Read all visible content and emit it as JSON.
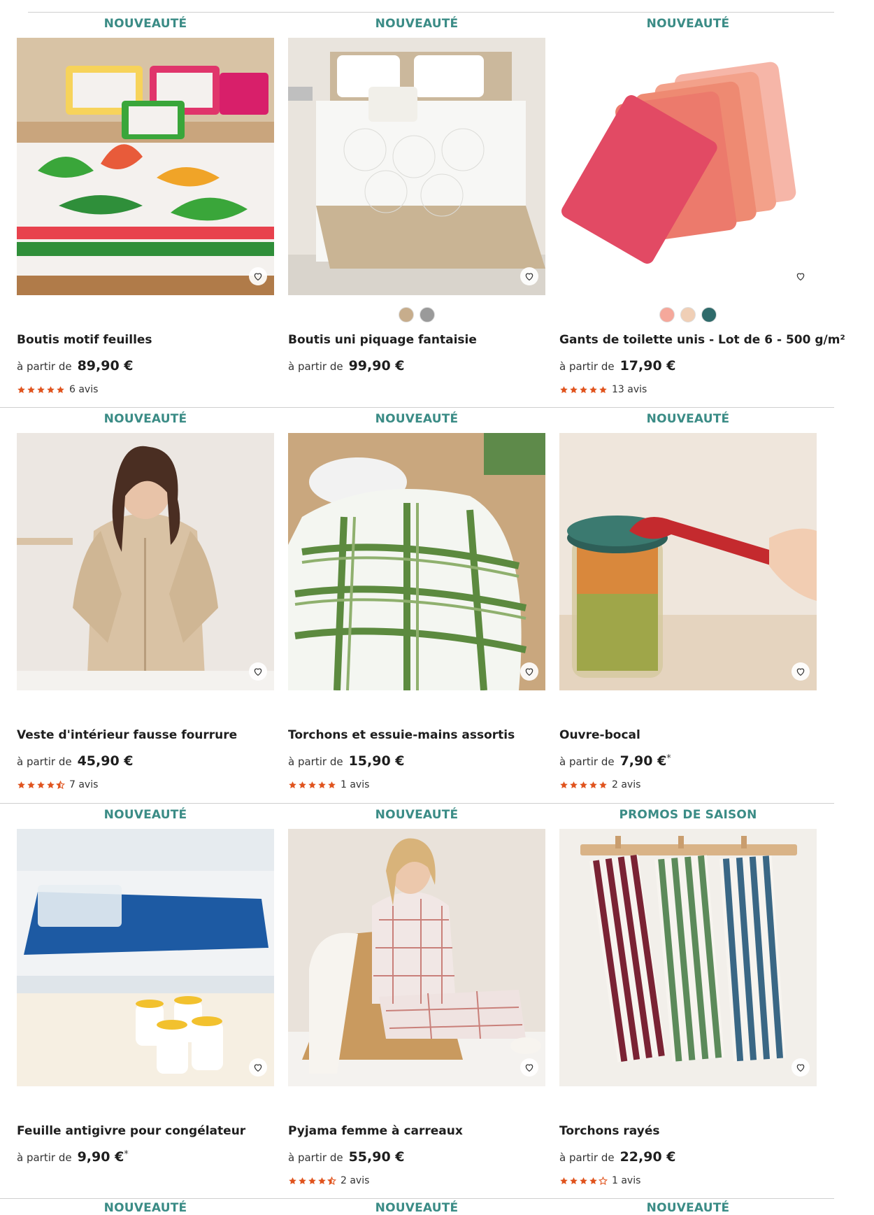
{
  "accent": "#3b8c86",
  "rating_color": "#e0541e",
  "products": [
    {
      "badge": "NOUVEAUTÉ",
      "title": "Boutis motif feuilles",
      "from": "à partir de",
      "price": "89,90 €",
      "asterisk": "",
      "rating": 5,
      "reviews": "6 avis",
      "swatches": [],
      "image": "floral-quilt-bed"
    },
    {
      "badge": "NOUVEAUTÉ",
      "title": "Boutis uni piquage fantaisie",
      "from": "à partir de",
      "price": "99,90 €",
      "asterisk": "",
      "rating": null,
      "reviews": "",
      "swatches": [
        "#c7ad8c",
        "#9a9a9a"
      ],
      "image": "white-quilt-bed"
    },
    {
      "badge": "NOUVEAUTÉ",
      "title": "Gants de toilette unis - Lot de 6 - 500 g/m²",
      "from": "à partir de",
      "price": "17,90 €",
      "asterisk": "",
      "rating": 5,
      "reviews": "13 avis",
      "swatches": [
        "#f5a89b",
        "#f0cfb6",
        "#2f6b6b"
      ],
      "image": "wash-mitts"
    },
    {
      "badge": "NOUVEAUTÉ",
      "title": "Veste d'intérieur fausse fourrure",
      "from": "à partir de",
      "price": "45,90 €",
      "asterisk": "",
      "rating": 4.5,
      "reviews": "7 avis",
      "swatches": [],
      "image": "fleece-jacket"
    },
    {
      "badge": "NOUVEAUTÉ",
      "title": "Torchons et essuie-mains assortis",
      "from": "à partir de",
      "price": "15,90 €",
      "asterisk": "",
      "rating": 5,
      "reviews": "1 avis",
      "swatches": [],
      "image": "tea-towels-green"
    },
    {
      "badge": "NOUVEAUTÉ",
      "title": "Ouvre-bocal",
      "from": "à partir de",
      "price": "7,90 €",
      "asterisk": "*",
      "rating": 5,
      "reviews": "2 avis",
      "swatches": [],
      "image": "jar-opener"
    },
    {
      "badge": "NOUVEAUTÉ",
      "title": "Feuille antigivre pour congélateur",
      "from": "à partir de",
      "price": "9,90 €",
      "asterisk": "*",
      "rating": null,
      "reviews": "",
      "swatches": [],
      "image": "freezer-sheet"
    },
    {
      "badge": "NOUVEAUTÉ",
      "title": "Pyjama femme à carreaux",
      "from": "à partir de",
      "price": "55,90 €",
      "asterisk": "",
      "rating": 4.5,
      "reviews": "2 avis",
      "swatches": [],
      "image": "checked-pyjama"
    },
    {
      "badge": "PROMOS DE SAISON",
      "title": "Torchons rayés",
      "from": "à partir de",
      "price": "22,90 €",
      "asterisk": "",
      "rating": 4,
      "reviews": "1 avis",
      "swatches": [],
      "image": "striped-towels"
    }
  ],
  "next_row_badges": [
    "NOUVEAUTÉ",
    "NOUVEAUTÉ",
    "NOUVEAUTÉ"
  ],
  "icons": {
    "favorite": "heart-outline-icon",
    "star": "star-icon"
  }
}
